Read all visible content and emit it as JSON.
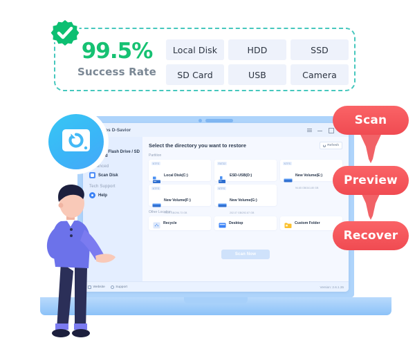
{
  "badge": {
    "seal_icon": "verified-check-badge",
    "rate_value": "99.5%",
    "rate_label": "Success Rate",
    "media_types": [
      "Local Disk",
      "HDD",
      "SSD",
      "SD Card",
      "USB",
      "Camera"
    ],
    "border_color": "#45c7bd",
    "accent_color": "#16c172"
  },
  "app": {
    "title": "dos D-Savior",
    "logo_icon": "disk-restore-icon",
    "window_controls": [
      "menu-icon",
      "minimize-icon",
      "maximize-icon",
      "close-icon"
    ],
    "sidebar": {
      "groups": [
        {
          "head": "Partition",
          "items": [
            {
              "label": "USB Flash Drive / SD Card",
              "icon": "usb-drive-icon"
            }
          ]
        },
        {
          "head": "Advanced",
          "items": [
            {
              "label": "Scan Disk",
              "icon": "scan-disk-icon"
            }
          ]
        },
        {
          "head": "Tech Support",
          "items": [
            {
              "label": "Help",
              "icon": "help-icon"
            }
          ]
        }
      ]
    },
    "main": {
      "title": "Select the directory you want to restore",
      "refresh_label": "Refresh",
      "partition_label": "Partition",
      "other_location_label": "Other Location",
      "scan_button": "Scan Now",
      "partitions": [
        {
          "fs": "NTFS",
          "name": "Local Disk(C:)",
          "size": "90.26 GB/237.65 GB",
          "used_pct": 38,
          "icon": "local-disk-icon"
        },
        {
          "fs": "FAT32",
          "name": "ESD-USB(D:)",
          "size": "17.77 MB/14.79 GB",
          "used_pct": 3,
          "icon": "usb-stick-icon"
        },
        {
          "fs": "NTFS",
          "name": "New Volume(E:)",
          "size": "94.65 GB/341.80 GB",
          "used_pct": 28,
          "icon": "hard-drive-icon"
        },
        {
          "fs": "NTFS",
          "name": "New Volume(F:)",
          "size": "73.29 GB/296.73 GB",
          "used_pct": 25,
          "icon": "hard-drive-icon"
        },
        {
          "fs": "NTFS",
          "name": "New Volume(G:)",
          "size": "202.07 GB/292.87 GB",
          "used_pct": 69,
          "icon": "hard-drive-icon"
        }
      ],
      "locations": [
        {
          "name": "Recycle",
          "icon": "recycle-bin-icon"
        },
        {
          "name": "Desktop",
          "icon": "desktop-folder-icon"
        },
        {
          "name": "Custom Folder",
          "icon": "custom-folder-icon"
        }
      ]
    },
    "statusbar": {
      "website_label": "Website",
      "support_label": "Support",
      "version": "Version: 2.6.1.35"
    }
  },
  "steps": [
    {
      "label": "Scan"
    },
    {
      "label": "Preview"
    },
    {
      "label": "Recover"
    }
  ],
  "steps_color": "#f04b52",
  "illustration": {
    "person_icon": "person-presenting-illustration"
  }
}
